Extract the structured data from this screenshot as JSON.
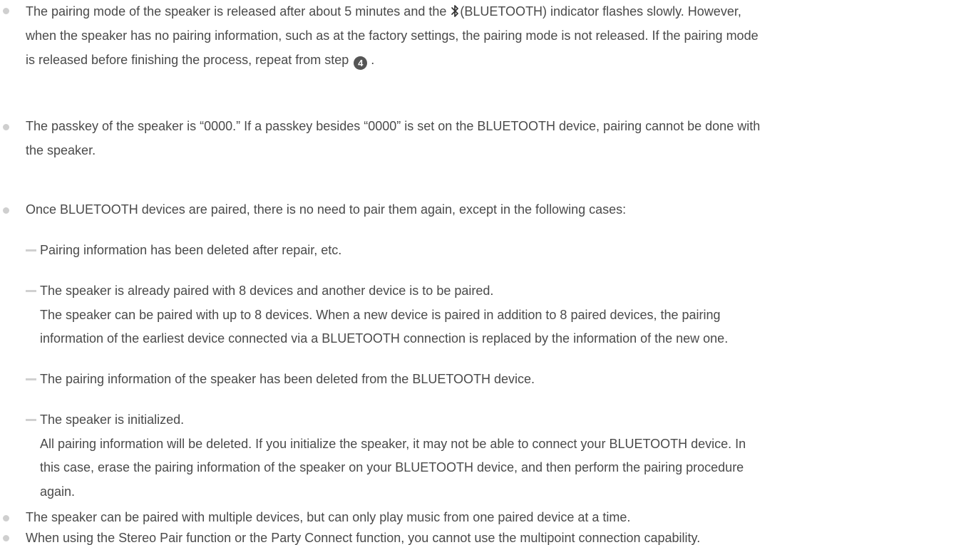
{
  "bullets": [
    {
      "line1_part1": "The pairing mode of the speaker is released after about 5 minutes and the ",
      "line1_part2": "(BLUETOOTH) indicator flashes slowly. However,",
      "line2": "when the speaker has no pairing information, such as at the factory settings, the pairing mode is not released. If the pairing mode",
      "line3": "is released before finishing the process, repeat from step ",
      "step": "4",
      "line3_end": " ."
    },
    {
      "line1": "The passkey of the speaker is “0000.” If a passkey besides “0000” is set on the BLUETOOTH device, pairing cannot be done with",
      "line2": "the speaker."
    },
    {
      "line1": "Once BLUETOOTH devices are paired, there is no need to pair them again, except in the following cases:",
      "cases": [
        {
          "lines": [
            "Pairing information has been deleted after repair, etc."
          ]
        },
        {
          "lines": [
            "The speaker is already paired with 8 devices and another device is to be paired.",
            "The speaker can be paired with up to 8 devices. When a new device is paired in addition to 8 paired devices, the pairing",
            "information of the earliest device connected via a BLUETOOTH connection is replaced by the information of the new one."
          ]
        },
        {
          "lines": [
            "The pairing information of the speaker has been deleted from the BLUETOOTH device."
          ]
        },
        {
          "lines": [
            "The speaker is initialized.",
            "All pairing information will be deleted. If you initialize the speaker, it may not be able to connect your BLUETOOTH device. In",
            "this case, erase the pairing information of the speaker on your BLUETOOTH device, and then perform the pairing procedure",
            "again."
          ]
        }
      ]
    },
    {
      "line1": "The speaker can be paired with multiple devices, but can only play music from one paired device at a time."
    },
    {
      "line1": "When using the Stereo Pair function or the Party Connect function, you cannot use the multipoint connection capability."
    }
  ],
  "icons": {
    "bullet": "bullet-dot-icon",
    "bluetooth": "bluetooth-icon",
    "step": "step-number-badge",
    "dash": "dash-icon"
  },
  "colors": {
    "text": "#4a4a4a",
    "bullet": "#cfcfcf",
    "dash": "#d0d0d0",
    "badge": "#555555"
  }
}
